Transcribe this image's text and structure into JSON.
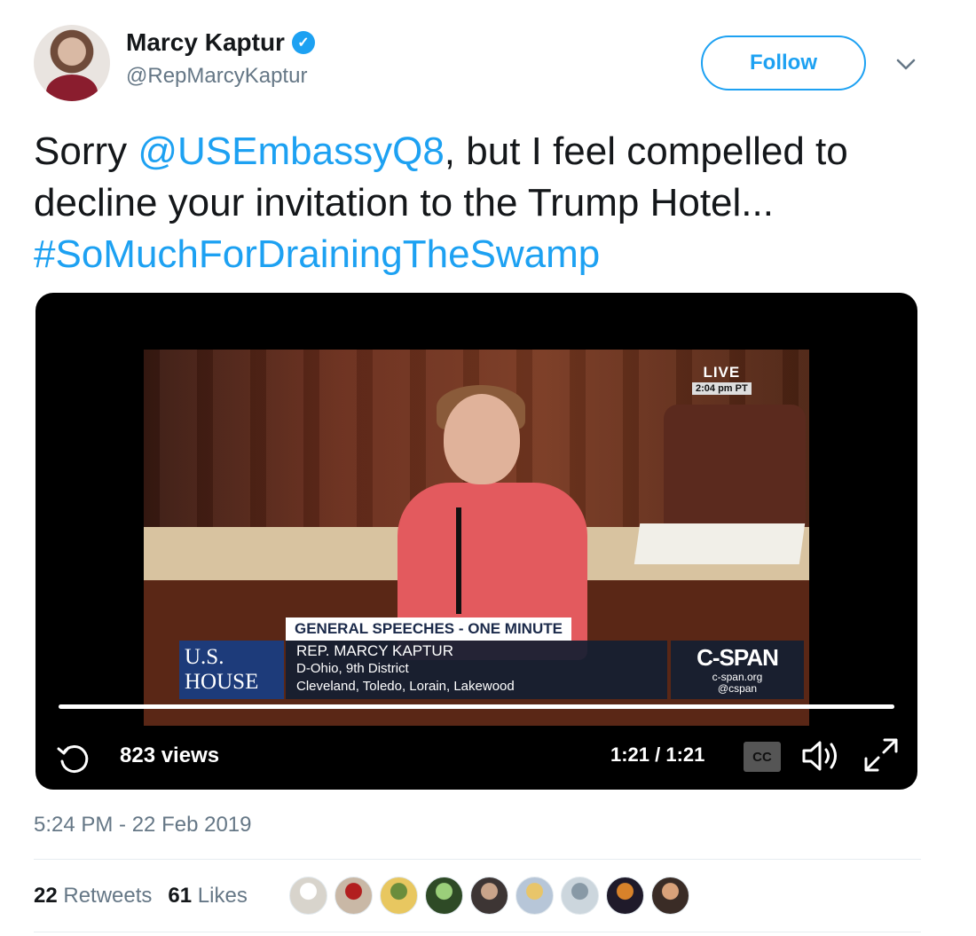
{
  "author": {
    "display_name": "Marcy Kaptur",
    "handle": "@RepMarcyKaptur",
    "verified": true
  },
  "follow_button": {
    "label": "Follow"
  },
  "tweet": {
    "text_before": "Sorry ",
    "mention": "@USEmbassyQ8",
    "text_middle": ", but I feel compelled to decline your invitation to the Trump Hotel... ",
    "hashtag": "#SoMuchForDrainingTheSwamp"
  },
  "video": {
    "live_label": "LIVE",
    "live_time": "2:04 pm PT",
    "house_logo": "U.S. HOUSE",
    "speech_title": "GENERAL SPEECHES - ONE MINUTE",
    "speaker_name": "REP. MARCY KAPTUR",
    "speaker_district": "D-Ohio, 9th District",
    "speaker_cities": "Cleveland, Toledo, Lorain, Lakewood",
    "cspan_logo": "C-SPAN",
    "cspan_url": "c-span.org",
    "cspan_handle": "@cspan",
    "progress_fraction": 1.0,
    "views": "823 views",
    "time": "1:21 / 1:21",
    "cc_label": "CC",
    "icons": [
      "replay-icon",
      "cc-icon",
      "volume-icon",
      "expand-icon"
    ]
  },
  "timestamp": "5:24 PM - 22 Feb 2019",
  "stats": {
    "retweets_count": "22",
    "retweets_label": "Retweets",
    "likes_count": "61",
    "likes_label": "Likes"
  },
  "liker_avatars": [
    {
      "bg": "#d8d4cc",
      "fg": "#ffffff"
    },
    {
      "bg": "#c9b8a6",
      "fg": "#b21f1f"
    },
    {
      "bg": "#e8c760",
      "fg": "#6a8d3c"
    },
    {
      "bg": "#2e4a26",
      "fg": "#9bcf7a"
    },
    {
      "bg": "#3d3534",
      "fg": "#c9a48a"
    },
    {
      "bg": "#b7c6d8",
      "fg": "#e8c56a"
    },
    {
      "bg": "#ccd6dd",
      "fg": "#8899a6"
    },
    {
      "bg": "#1f1a2a",
      "fg": "#d8822a"
    },
    {
      "bg": "#3a2c26",
      "fg": "#d9a27a"
    }
  ],
  "colors": {
    "accent": "#1da1f2",
    "text_primary": "#14171a",
    "text_secondary": "#657786"
  }
}
